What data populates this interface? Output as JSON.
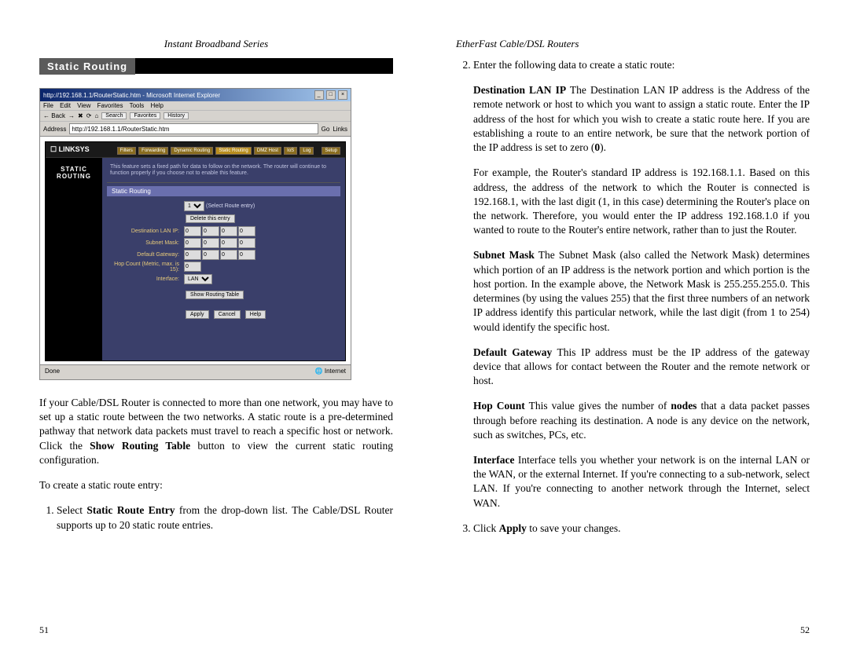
{
  "left_page": {
    "series_title": "Instant Broadband Series",
    "section_heading": "Static Routing",
    "screenshot": {
      "window_title": "http://192.168.1.1/RouterStatic.htm - Microsoft Internet Explorer",
      "menu": [
        "File",
        "Edit",
        "View",
        "Favorites",
        "Tools",
        "Help"
      ],
      "toolbar": {
        "back": "Back",
        "search": "Search",
        "favorites": "Favorites",
        "history": "History"
      },
      "address_label": "Address",
      "address_value": "http://192.168.1.1/RouterStatic.htm",
      "go_label": "Go",
      "links_label": "Links",
      "brand": "LINKSYS",
      "tabs": [
        "Filters",
        "Forwarding",
        "Dynamic Routing",
        "Static Routing",
        "DMZ Host",
        "IoS",
        "Log"
      ],
      "tab_setup": "Setup",
      "left_heading_line1": "STATIC",
      "left_heading_line2": "ROUTING",
      "description": "This feature sets a fixed path for data to follow on the network. The router will continue to function properly if you choose not to enable this feature.",
      "form_head": "Static Routing",
      "route_select_label": "(Select Route entry)",
      "delete_entry_btn": "Delete this entry",
      "labels": {
        "dest_ip": "Destination LAN IP:",
        "subnet": "Subnet Mask:",
        "gateway": "Default Gateway:",
        "hop": "Hop Count (Metric, max. is 15):",
        "interface": "Interface:"
      },
      "ip_val": "0",
      "hop_val": "0",
      "iface_val": "LAN",
      "show_table_btn": "Show Routing Table",
      "apply_btn": "Apply",
      "cancel_btn": "Cancel",
      "help_btn": "Help",
      "status_done": "Done",
      "status_inet": "Internet"
    },
    "para_intro": "If your Cable/DSL Router is connected to more than one network, you may have to set up a static route between the two networks. A static route is a pre-determined pathway that network data packets must travel to reach a specific host or network.  Click the ",
    "para_intro_bold": "Show Routing Table",
    "para_intro_tail": " button to view the current static routing configuration.",
    "para_create": "To create a static route entry:",
    "step1_a": "Select ",
    "step1_bold": "Static Route Entry",
    "step1_b": " from the drop-down list. The Cable/DSL Router supports up to 20 static route entries.",
    "page_num": "51"
  },
  "right_page": {
    "series_title": "EtherFast Cable/DSL Routers",
    "step2_lead": "Enter the following data to create a static route:",
    "dest_term": "Destination LAN IP",
    "dest_text_a": "  The Destination LAN IP address is the Address of the remote network or host to which you want to assign a static route. Enter the IP address of the host for which you wish to create a static route here. If you are establishing a route to an entire network, be sure that the network portion of the IP address is set to zero (",
    "dest_bold_zero": "0",
    "dest_text_b": ").",
    "dest_example": "For example, the Router's standard IP address is 192.168.1.1. Based on this address, the address of the network to which the Router is connected is 192.168.1, with the last digit (1, in this case) determining the Router's place on the network. Therefore, you would enter the IP address 192.168.1.0 if you wanted to route to the Router's entire network, rather than to just the Router.",
    "subnet_term": "Subnet Mask",
    "subnet_text": "  The Subnet Mask (also called the Network Mask) determines which portion of an IP address is the network portion and which portion is the host portion. In the example above, the Network Mask is 255.255.255.0. This determines (by using the values 255) that the first three numbers of an network IP address identify this particular network, while the last digit (from 1 to 254) would identify the specific host.",
    "gateway_term": "Default Gateway",
    "gateway_text": "  This IP address must be the IP address of the gateway device that allows for contact between the Router and the remote network or host.",
    "hop_term": "Hop Count",
    "hop_text_a": "  This value gives the number of ",
    "hop_bold": "nodes",
    "hop_text_b": " that a data packet passes through before reaching its destination.  A node is any device on the network, such as switches, PCs, etc.",
    "iface_term": "Interface",
    "iface_text": "   Interface tells you whether your network is on the internal LAN or the WAN, or the external Internet.  If you're connecting to a sub-network, select LAN.  If you're connecting to another network through the Internet, select WAN.",
    "step3_a": "Click ",
    "step3_bold": "Apply",
    "step3_b": " to save your changes.",
    "page_num": "52"
  }
}
